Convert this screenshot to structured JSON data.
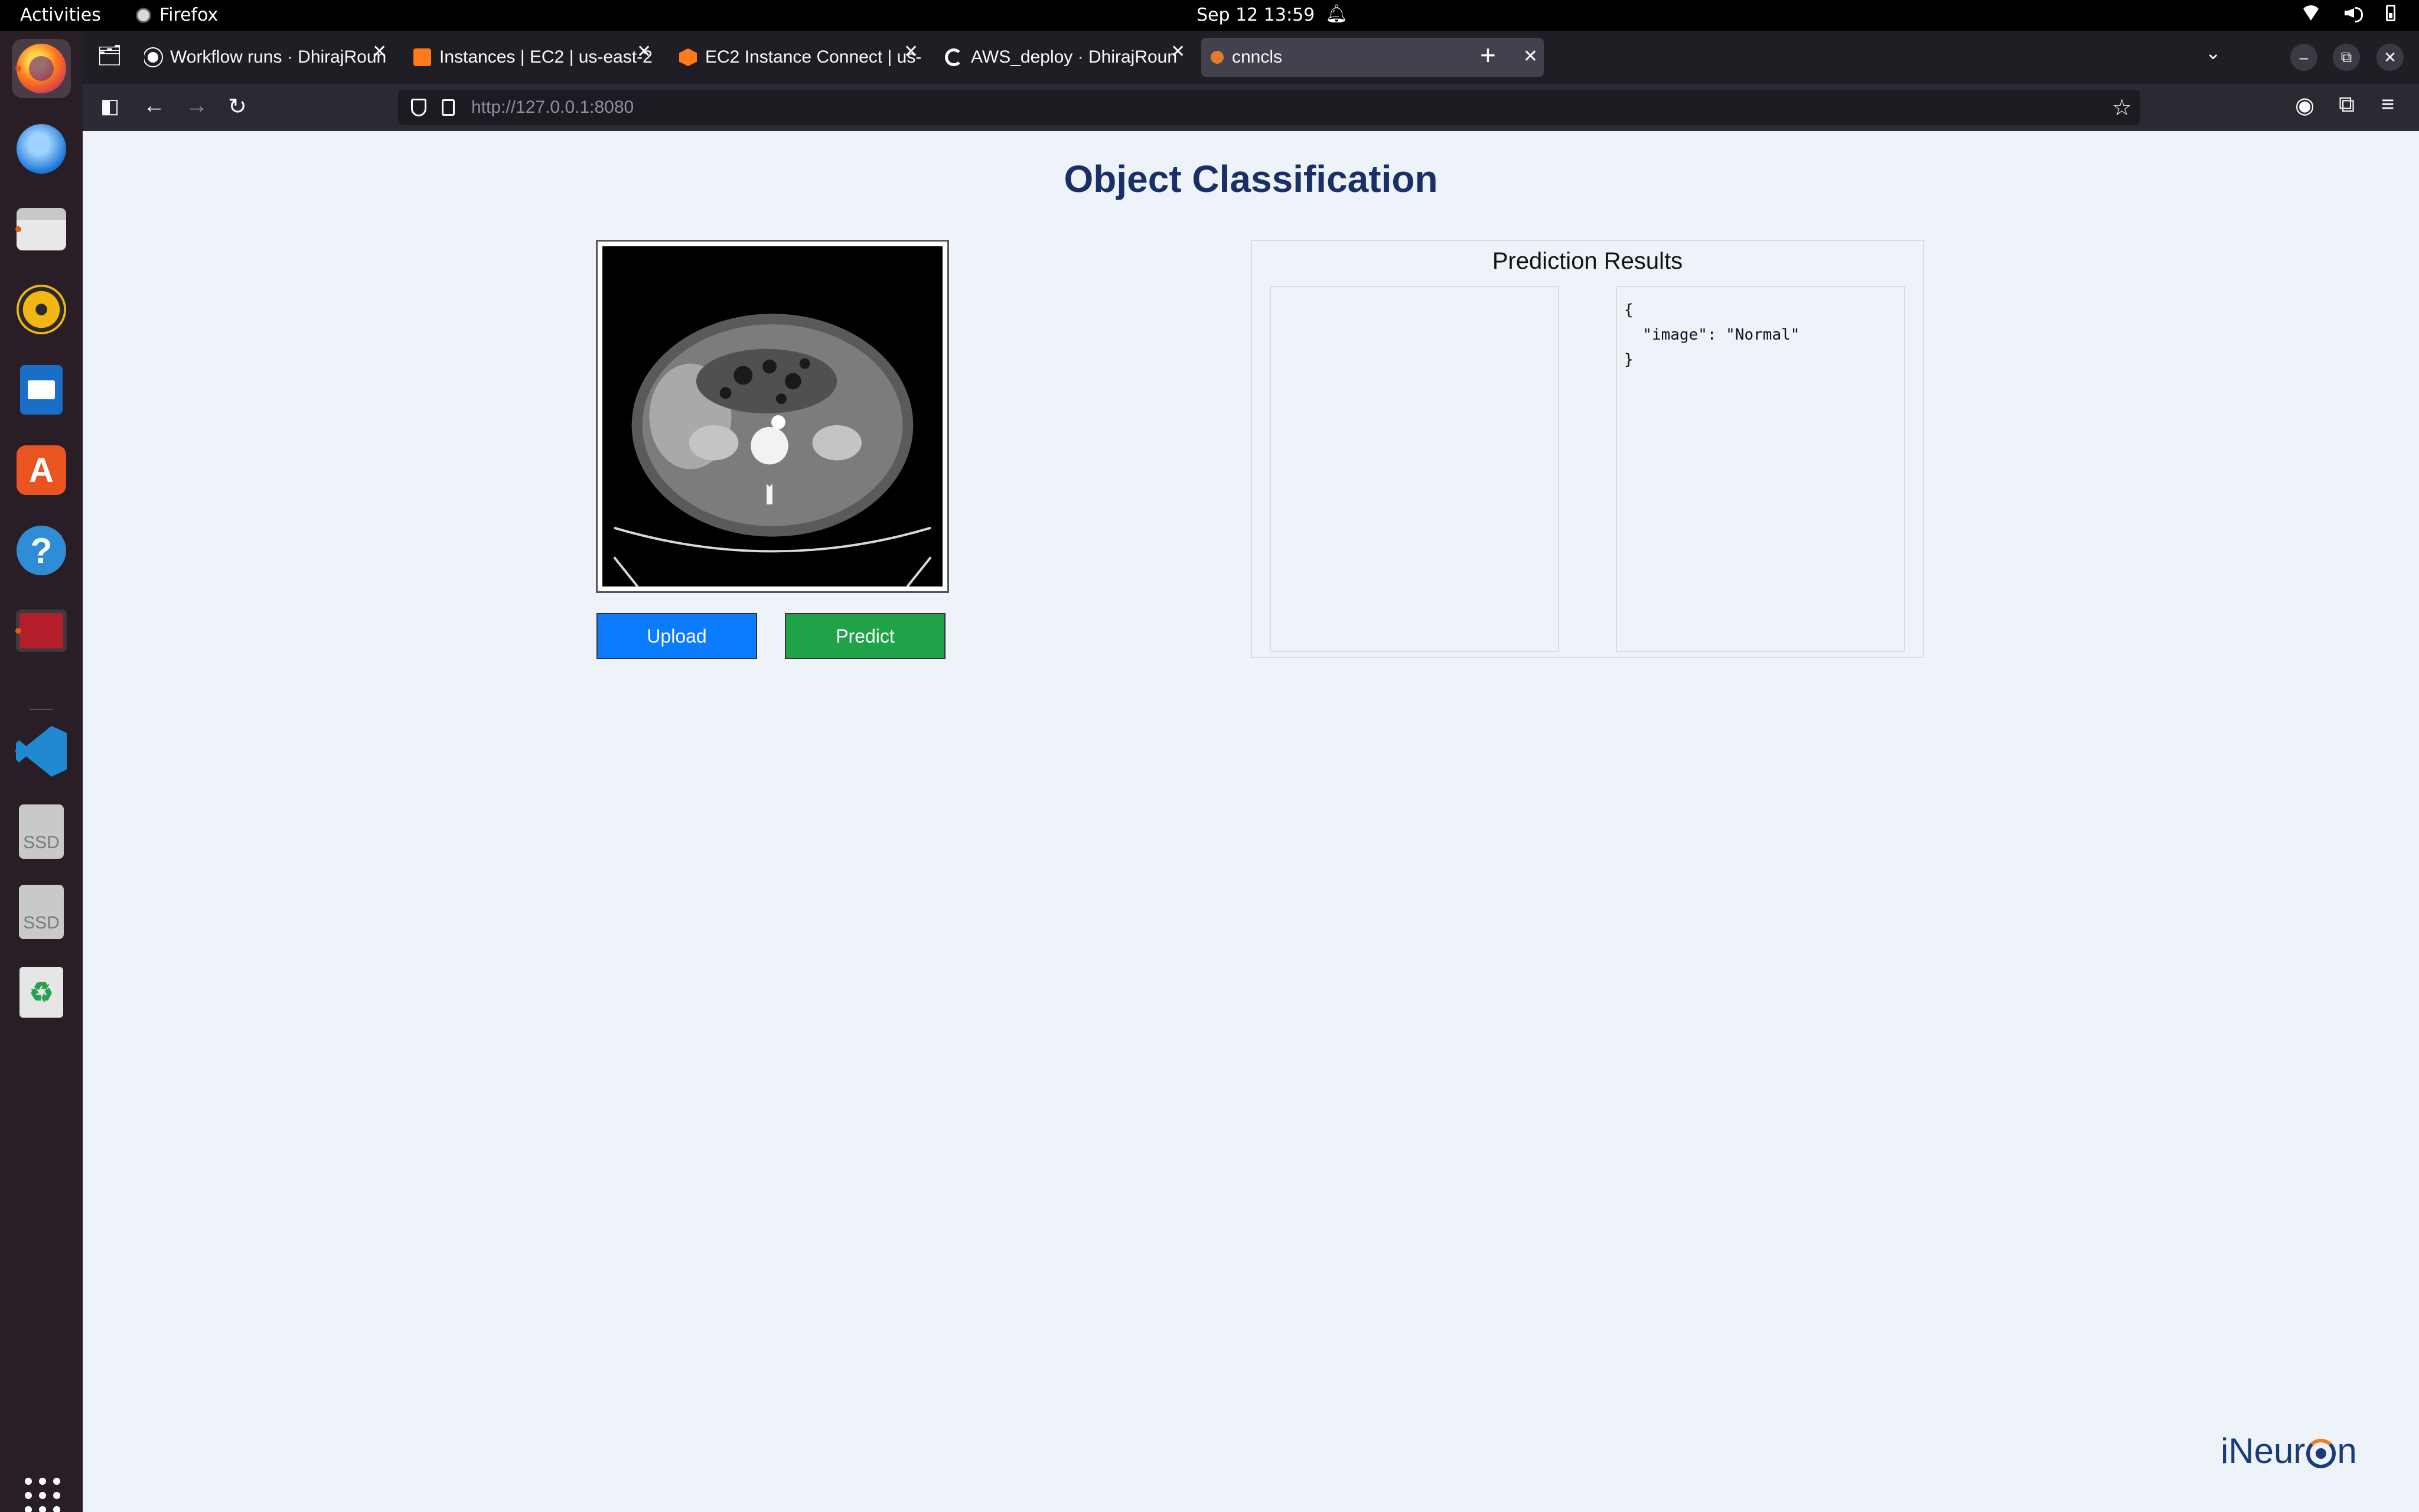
{
  "os": {
    "activities": "Activities",
    "app_name": "Firefox",
    "clock": "Sep 12  13:59"
  },
  "dock": {
    "items": [
      {
        "name": "firefox-icon",
        "running": true
      },
      {
        "name": "thunderbird-icon",
        "running": false
      },
      {
        "name": "files-icon",
        "running": true
      },
      {
        "name": "rhythmbox-icon",
        "running": false
      },
      {
        "name": "libreoffice-writer-icon",
        "running": false
      },
      {
        "name": "app-center-icon",
        "running": false
      },
      {
        "name": "help-icon",
        "running": false
      },
      {
        "name": "terminal-icon",
        "running": true
      },
      {
        "name": "vscode-icon",
        "running": true
      },
      {
        "name": "ssd-drive-icon",
        "running": false
      },
      {
        "name": "ssd-drive-icon",
        "running": false
      },
      {
        "name": "trash-icon",
        "running": false
      }
    ],
    "ssd_label": "SSD"
  },
  "browser": {
    "tabs": [
      {
        "label": "Workflow runs · DhirajRoun",
        "active": false
      },
      {
        "label": "Instances | EC2 | us-east-2",
        "active": false
      },
      {
        "label": "EC2 Instance Connect | us-",
        "active": false
      },
      {
        "label": "AWS_deploy · DhirajRoun",
        "active": false
      },
      {
        "label": "cnncls",
        "active": true
      }
    ],
    "url_host": "http://127.0.0.1",
    "url_port": ":8080"
  },
  "page": {
    "title": "Object Classification",
    "upload_label": "Upload",
    "predict_label": "Predict",
    "results_title": "Prediction Results",
    "results_json": "{\n  \"image\": \"Normal\"\n}",
    "logo_pre": "iNeur",
    "logo_post": "n"
  },
  "colors": {
    "upload_button": "#0b7cff",
    "predict_button": "#1fa248",
    "title": "#1a2f66",
    "page_background": "#eef2f9"
  }
}
